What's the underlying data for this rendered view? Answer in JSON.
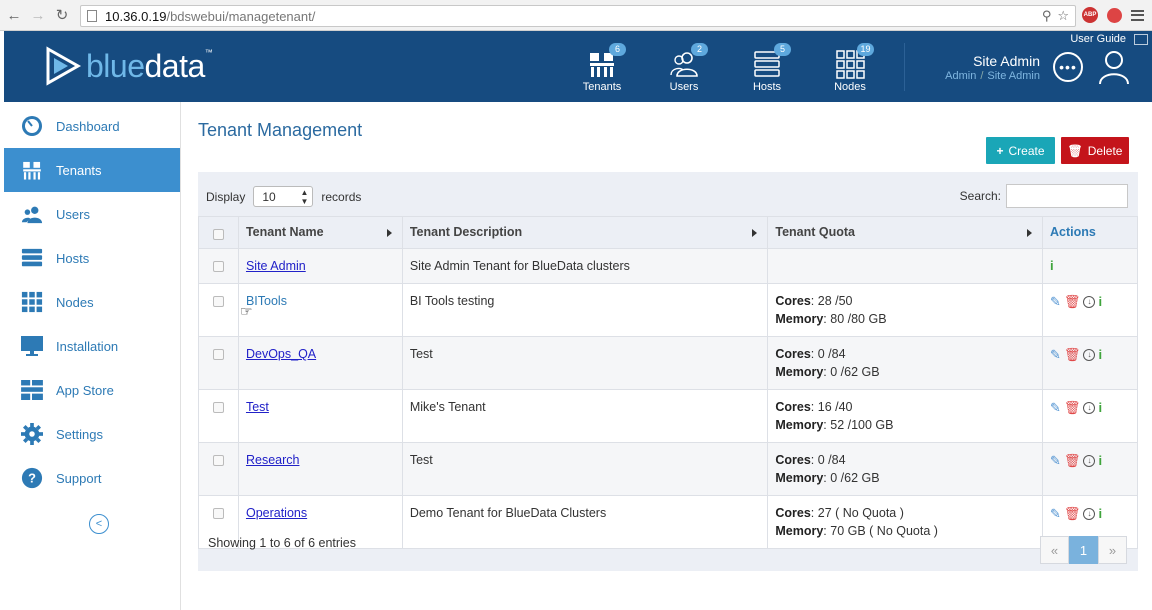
{
  "browser": {
    "url_host": "10.36.0.19",
    "url_path": "/bdswebui/managetenant/",
    "abp_label": "ABP"
  },
  "header": {
    "logo_blue": "blue",
    "logo_data": "data",
    "logo_tm": "™",
    "nav": [
      {
        "label": "Tenants",
        "badge": "6"
      },
      {
        "label": "Users",
        "badge": "2"
      },
      {
        "label": "Hosts",
        "badge": "5"
      },
      {
        "label": "Nodes",
        "badge": "19"
      }
    ],
    "user_guide": "User Guide",
    "site_admin": "Site Admin",
    "crumb_1": "Admin",
    "crumb_sep": "/",
    "crumb_2": "Site Admin",
    "more": "•••"
  },
  "sidebar": {
    "items": [
      {
        "label": "Dashboard",
        "icon": "gauge-icon"
      },
      {
        "label": "Tenants",
        "icon": "tenants-icon",
        "active": true
      },
      {
        "label": "Users",
        "icon": "users-icon"
      },
      {
        "label": "Hosts",
        "icon": "hosts-icon"
      },
      {
        "label": "Nodes",
        "icon": "nodes-icon"
      },
      {
        "label": "Installation",
        "icon": "monitor-icon"
      },
      {
        "label": "App Store",
        "icon": "app-store-icon"
      },
      {
        "label": "Settings",
        "icon": "gear-icon"
      },
      {
        "label": "Support",
        "icon": "help-icon"
      }
    ],
    "collapse": "<"
  },
  "main": {
    "title": "Tenant Management",
    "create_label": "Create",
    "delete_label": "Delete",
    "display_label": "Display",
    "page_size": "10",
    "records_label": "records",
    "search_label": "Search:",
    "columns": {
      "name": "Tenant Name",
      "description": "Tenant Description",
      "quota": "Tenant Quota",
      "actions": "Actions"
    },
    "cores_label": "Cores",
    "memory_label": "Memory",
    "rows": [
      {
        "name": "Site Admin",
        "description": "Site Admin Tenant for BlueData clusters",
        "cores": "",
        "memory": ""
      },
      {
        "name": "BITools",
        "description": "BI Tools testing",
        "cores": ": 28 /50",
        "memory": ": 80 /80 GB"
      },
      {
        "name": "DevOps_QA",
        "description": "Test",
        "cores": ": 0 /84",
        "memory": ": 0 /62 GB"
      },
      {
        "name": "Test",
        "description": "Mike's Tenant",
        "cores": ": 16 /40",
        "memory": ": 52 /100 GB"
      },
      {
        "name": "Research",
        "description": "Test",
        "cores": ": 0 /84",
        "memory": ": 0 /62 GB"
      },
      {
        "name": "Operations",
        "description": "Demo Tenant for BlueData Clusters",
        "cores": ": 27 ( No Quota )",
        "memory": ": 70 GB ( No Quota )"
      }
    ],
    "showing": "Showing 1 to 6 of 6 entries",
    "pager": {
      "prev": "«",
      "current": "1",
      "next": "»"
    }
  }
}
